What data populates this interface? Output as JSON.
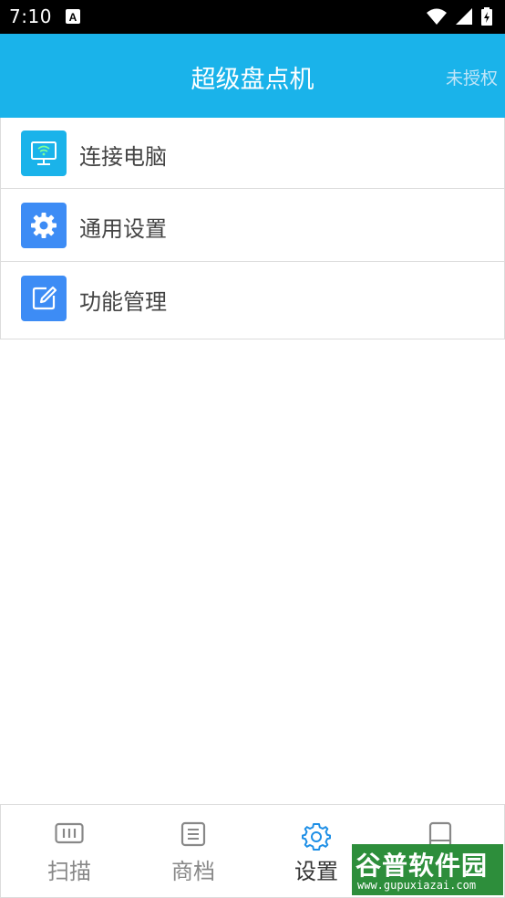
{
  "status_bar": {
    "time": "7:10"
  },
  "app_bar": {
    "title": "超级盘点机",
    "action": "未授权"
  },
  "menu": {
    "items": [
      {
        "label": "连接电脑",
        "icon": "monitor-wifi-icon",
        "color": "#1ab3ea"
      },
      {
        "label": "通用设置",
        "icon": "gear-icon",
        "color": "#3d8cf5"
      },
      {
        "label": "功能管理",
        "icon": "edit-icon",
        "color": "#3d8cf5"
      }
    ]
  },
  "tabs": [
    {
      "label": "扫描",
      "icon": "barcode-icon",
      "active": false
    },
    {
      "label": "商档",
      "icon": "list-doc-icon",
      "active": false
    },
    {
      "label": "设置",
      "icon": "gear-icon",
      "active": true
    },
    {
      "label": "",
      "icon": "book-icon",
      "active": false
    }
  ],
  "colors": {
    "primary": "#1ab3ea",
    "active_tab": "#1e8fe6",
    "inactive_tab": "#888888"
  },
  "watermark": {
    "brand": "谷普软件园",
    "url": "www.gupuxiazai.com"
  }
}
